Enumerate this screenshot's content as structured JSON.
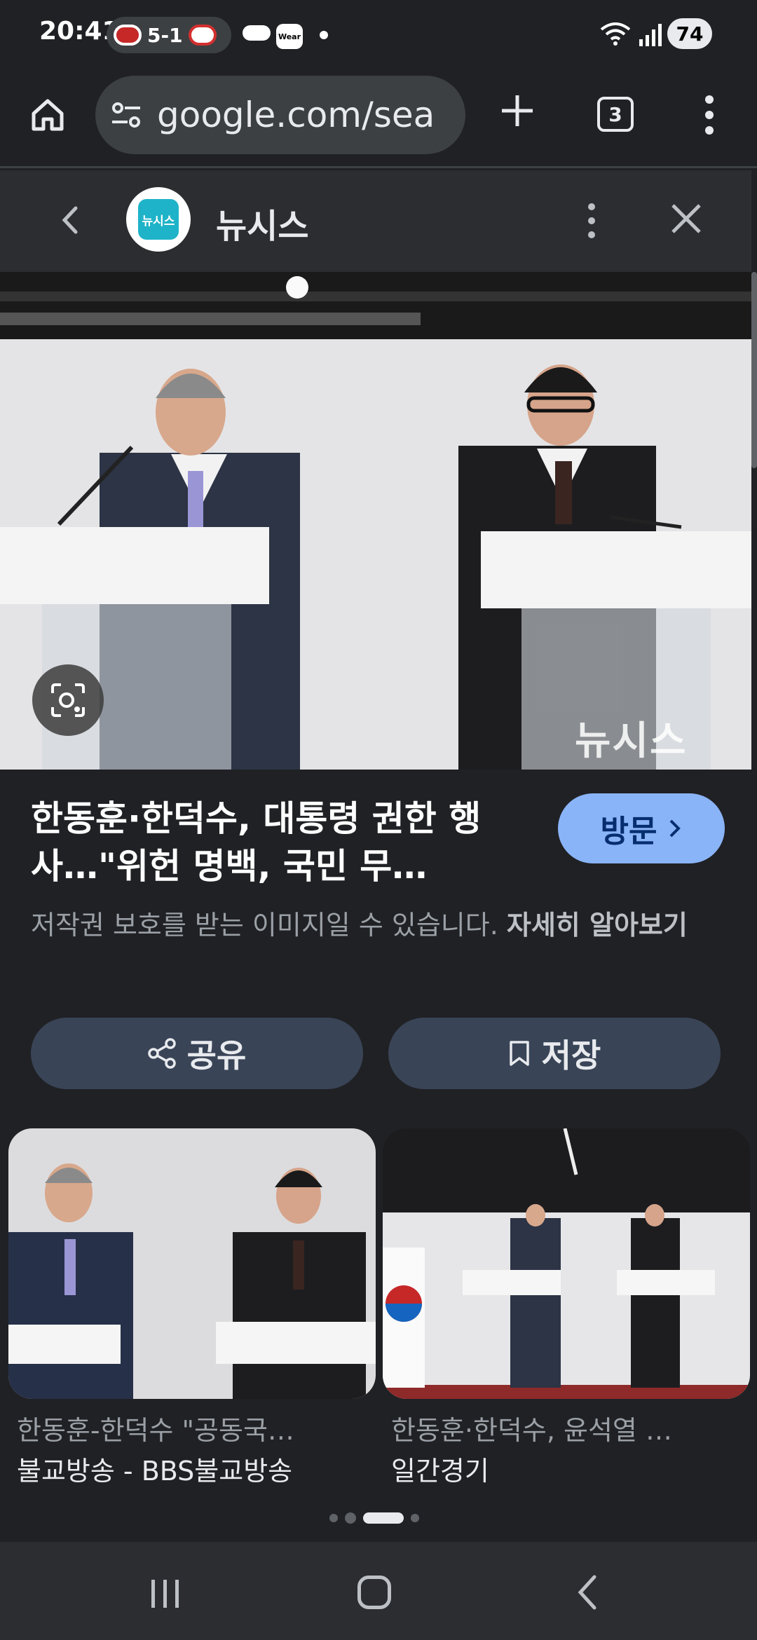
{
  "status_bar": {
    "time": "20:41",
    "score": "5-1",
    "wear_label": "Wear",
    "battery": "74"
  },
  "browser": {
    "url": "google.com/sea",
    "tab_count": "3"
  },
  "source": {
    "name": "뉴시스",
    "logo_text": "뉴시스"
  },
  "image": {
    "watermark": "뉴시스"
  },
  "result": {
    "headline": "한동훈·한덕수, 대통령 권한 행사…\"위헌 명백, 국민 무…",
    "visit_label": "방문",
    "copyright_text": "저작권 보호를 받는 이미지일 수 있습니다. ",
    "learn_more": "자세히 알아보기",
    "share_label": "공유",
    "save_label": "저장"
  },
  "related": [
    {
      "title": "한동훈-한덕수 \"공동국…",
      "source": "불교방송 - BBS불교방송"
    },
    {
      "title": "한동훈·한덕수, 윤석열 …",
      "source": "일간경기"
    }
  ],
  "colors": {
    "background": "#202124",
    "visit_button": "#8ab4f8",
    "action_button": "#394457",
    "logo_teal": "#1eb3c8"
  }
}
